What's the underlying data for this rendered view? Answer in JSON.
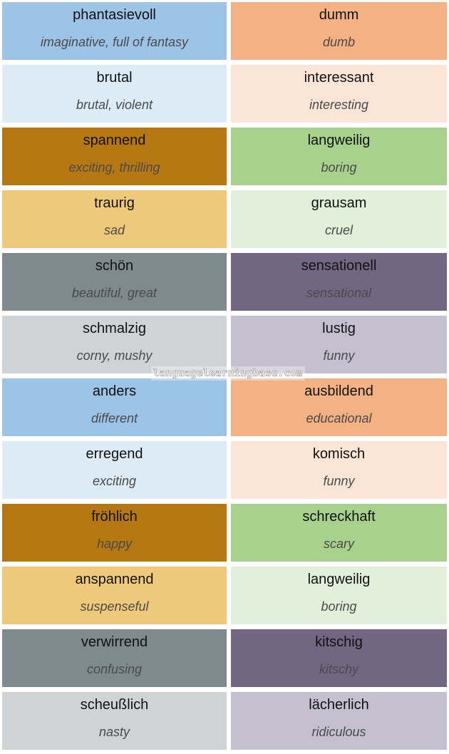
{
  "colors": {
    "blue": "#9dc3e6",
    "light_blue": "#ddebf7",
    "brown": "#b57812",
    "yellow": "#efc97a",
    "gray": "#7f8a8f",
    "light_gray": "#d0d3d5",
    "orange": "#f4b183",
    "peach": "#fbe5d6",
    "green": "#a9d18e",
    "light_green": "#e2efda",
    "purple": "#736683",
    "lavender": "#c5c0cf"
  },
  "watermark": "languagelearningbase.com",
  "cards": [
    {
      "de": "phantasievoll",
      "en": "imaginative, full of fantasy",
      "color": "#9dc3e6"
    },
    {
      "de": "dumm",
      "en": "dumb",
      "color": "#f4b183"
    },
    {
      "de": "brutal",
      "en": "brutal, violent",
      "color": "#ddebf7"
    },
    {
      "de": "interessant",
      "en": "interesting",
      "color": "#fbe5d6"
    },
    {
      "de": "spannend",
      "en": "exciting, thrilling",
      "color": "#b57812"
    },
    {
      "de": "langweilig",
      "en": "boring",
      "color": "#a9d18e"
    },
    {
      "de": "traurig",
      "en": "sad",
      "color": "#efc97a"
    },
    {
      "de": "grausam",
      "en": "cruel",
      "color": "#e2efda"
    },
    {
      "de": "schön",
      "en": "beautiful, great",
      "color": "#7f8a8f"
    },
    {
      "de": "sensationell",
      "en": "sensational",
      "color": "#736683"
    },
    {
      "de": "schmalzig",
      "en": "corny, mushy",
      "color": "#d0d3d5"
    },
    {
      "de": "lustig",
      "en": "funny",
      "color": "#c5c0cf"
    },
    {
      "de": "anders",
      "en": "different",
      "color": "#9dc3e6"
    },
    {
      "de": "ausbildend",
      "en": "educational",
      "color": "#f4b183"
    },
    {
      "de": "erregend",
      "en": "exciting",
      "color": "#ddebf7"
    },
    {
      "de": "komisch",
      "en": "funny",
      "color": "#fbe5d6"
    },
    {
      "de": "fröhlich",
      "en": "happy",
      "color": "#b57812"
    },
    {
      "de": "schreckhaft",
      "en": "scary",
      "color": "#a9d18e"
    },
    {
      "de": "anspannend",
      "en": "suspenseful",
      "color": "#efc97a"
    },
    {
      "de": "langweilig",
      "en": "boring",
      "color": "#e2efda"
    },
    {
      "de": "verwirrend",
      "en": "confusing",
      "color": "#7f8a8f"
    },
    {
      "de": "kitschig",
      "en": "kitschy",
      "color": "#736683"
    },
    {
      "de": "scheußlich",
      "en": "nasty",
      "color": "#d0d3d5"
    },
    {
      "de": "lächerlich",
      "en": "ridiculous",
      "color": "#c5c0cf"
    }
  ]
}
